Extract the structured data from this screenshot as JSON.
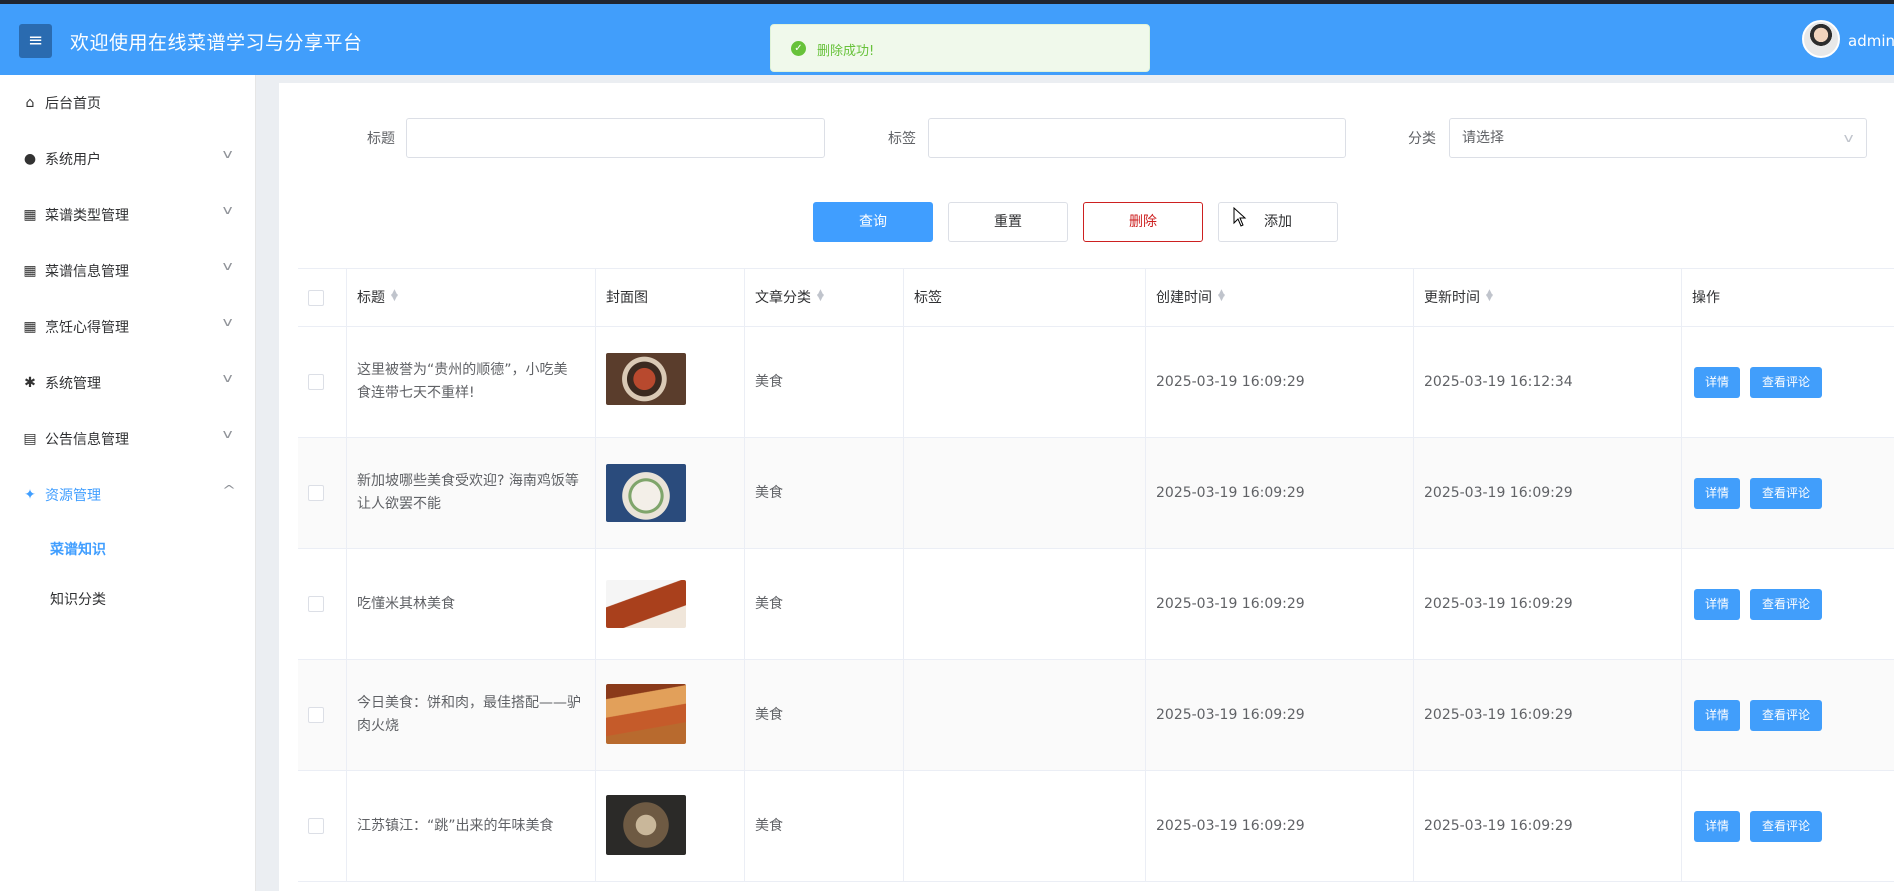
{
  "header": {
    "title": "欢迎使用在线菜谱学习与分享平台",
    "menu_icon": "menu-icon",
    "username": "admin"
  },
  "toast": {
    "message": "删除成功!",
    "color": "#67c23a"
  },
  "sidebar": {
    "items": [
      {
        "label": "后台首页",
        "icon": "home-icon"
      },
      {
        "label": "系统用户",
        "icon": "user-icon"
      },
      {
        "label": "菜谱类型管理",
        "icon": "grid-icon"
      },
      {
        "label": "菜谱信息管理",
        "icon": "grid-icon"
      },
      {
        "label": "烹饪心得管理",
        "icon": "grid-icon"
      },
      {
        "label": "系统管理",
        "icon": "gear-icon"
      },
      {
        "label": "公告信息管理",
        "icon": "doc-icon"
      },
      {
        "label": "资源管理",
        "icon": "compass-icon"
      }
    ],
    "subitems": [
      {
        "label": "菜谱知识",
        "active": true
      },
      {
        "label": "知识分类",
        "active": false
      }
    ]
  },
  "filters": {
    "title_label": "标题",
    "tag_label": "标签",
    "category_label": "分类",
    "category_placeholder": "请选择"
  },
  "buttons": {
    "search": "查询",
    "reset": "重置",
    "delete": "删除",
    "add": "添加"
  },
  "table": {
    "columns": [
      "标题",
      "封面图",
      "文章分类",
      "标签",
      "创建时间",
      "更新时间",
      "操作"
    ],
    "detail_label": "详情",
    "comments_label": "查看评论",
    "rows": [
      {
        "title_line1": "这里被誉为“贵州的顺德”，小吃美",
        "title_line2": "食连带七天不重样!",
        "category": "美食",
        "tag": "",
        "created": "2025-03-19 16:09:29",
        "updated": "2025-03-19 16:12:34"
      },
      {
        "title_line1": "新加坡哪些美食受欢迎? 海南鸡饭等",
        "title_line2": "让人欲罢不能",
        "category": "美食",
        "tag": "",
        "created": "2025-03-19 16:09:29",
        "updated": "2025-03-19 16:09:29"
      },
      {
        "title_line1": "吃懂米其林美食",
        "title_line2": "",
        "category": "美食",
        "tag": "",
        "created": "2025-03-19 16:09:29",
        "updated": "2025-03-19 16:09:29"
      },
      {
        "title_line1": "今日美食：饼和肉，最佳搭配——驴",
        "title_line2": "肉火烧",
        "category": "美食",
        "tag": "",
        "created": "2025-03-19 16:09:29",
        "updated": "2025-03-19 16:09:29"
      },
      {
        "title_line1": "江苏镇江：“跳”出来的年味美食",
        "title_line2": "",
        "category": "美食",
        "tag": "",
        "created": "2025-03-19 16:09:29",
        "updated": "2025-03-19 16:09:29"
      }
    ]
  },
  "colors": {
    "header": "#419efb",
    "primary": "#409eff",
    "danger": "#cd2020"
  }
}
